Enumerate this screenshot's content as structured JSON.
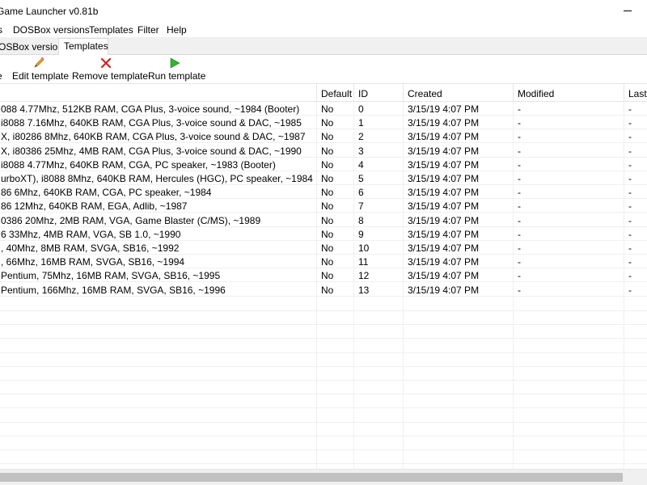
{
  "window": {
    "title": "Game Launcher v0.81b"
  },
  "menu": [
    {
      "label": "s",
      "name": "menu-first"
    },
    {
      "label": "DOSBox versions",
      "name": "menu-dosbox-versions"
    },
    {
      "label": "Templates",
      "name": "menu-templates"
    },
    {
      "label": "Filter",
      "name": "menu-filter"
    },
    {
      "label": "Help",
      "name": "menu-help"
    }
  ],
  "tabs": [
    {
      "label": "OSBox versions",
      "active": false
    },
    {
      "label": "Templates",
      "active": true
    }
  ],
  "toolbar": {
    "partial_label": "e",
    "edit_label": "Edit template",
    "remove_label": "Remove template",
    "run_label": "Run template",
    "colors": {
      "edit_icon": "#e8a21a",
      "remove_icon": "#d81e1e",
      "run_icon": "#2fb52f"
    }
  },
  "table": {
    "columns": [
      "",
      "Default",
      "ID",
      "Created",
      "Modified",
      "Last s"
    ],
    "rows": [
      {
        "name": "088 4.77Mhz, 512KB RAM, CGA Plus, 3-voice sound, ~1984 (Booter)",
        "default": "No",
        "id": "0",
        "created": "3/15/19 4:07 PM",
        "modified": "-",
        "last": "-"
      },
      {
        "name": "i8088 7.16Mhz, 640KB RAM, CGA Plus, 3-voice sound & DAC, ~1985",
        "default": "No",
        "id": "1",
        "created": "3/15/19 4:07 PM",
        "modified": "-",
        "last": "-"
      },
      {
        "name": "X, i80286 8Mhz, 640KB RAM, CGA Plus, 3-voice sound & DAC, ~1987",
        "default": "No",
        "id": "2",
        "created": "3/15/19 4:07 PM",
        "modified": "-",
        "last": "-"
      },
      {
        "name": "X, i80386 25Mhz, 4MB RAM, CGA Plus, 3-voice sound & DAC, ~1990",
        "default": "No",
        "id": "3",
        "created": "3/15/19 4:07 PM",
        "modified": "-",
        "last": "-"
      },
      {
        "name": "i8088 4.77Mhz, 640KB RAM, CGA, PC speaker, ~1983 (Booter)",
        "default": "No",
        "id": "4",
        "created": "3/15/19 4:07 PM",
        "modified": "-",
        "last": "-"
      },
      {
        "name": "urboXT), i8088 8Mhz, 640KB RAM, Hercules (HGC), PC speaker, ~1984",
        "default": "No",
        "id": "5",
        "created": "3/15/19 4:07 PM",
        "modified": "-",
        "last": "-"
      },
      {
        "name": "86 6Mhz, 640KB RAM, CGA, PC speaker, ~1984",
        "default": "No",
        "id": "6",
        "created": "3/15/19 4:07 PM",
        "modified": "-",
        "last": "-"
      },
      {
        "name": "86 12Mhz, 640KB RAM, EGA, Adlib, ~1987",
        "default": "No",
        "id": "7",
        "created": "3/15/19 4:07 PM",
        "modified": "-",
        "last": "-"
      },
      {
        "name": "0386 20Mhz, 2MB RAM, VGA, Game Blaster (C/MS), ~1989",
        "default": "No",
        "id": "8",
        "created": "3/15/19 4:07 PM",
        "modified": "-",
        "last": "-"
      },
      {
        "name": "6 33Mhz, 4MB RAM, VGA, SB 1.0, ~1990",
        "default": "No",
        "id": "9",
        "created": "3/15/19 4:07 PM",
        "modified": "-",
        "last": "-"
      },
      {
        "name": ", 40Mhz, 8MB RAM, SVGA, SB16, ~1992",
        "default": "No",
        "id": "10",
        "created": "3/15/19 4:07 PM",
        "modified": "-",
        "last": "-"
      },
      {
        "name": ", 66Mhz, 16MB RAM, SVGA, SB16, ~1994",
        "default": "No",
        "id": "11",
        "created": "3/15/19 4:07 PM",
        "modified": "-",
        "last": "-"
      },
      {
        "name": "Pentium, 75Mhz, 16MB RAM, SVGA, SB16, ~1995",
        "default": "No",
        "id": "12",
        "created": "3/15/19 4:07 PM",
        "modified": "-",
        "last": "-"
      },
      {
        "name": "Pentium, 166Mhz, 16MB RAM, SVGA, SB16, ~1996",
        "default": "No",
        "id": "13",
        "created": "3/15/19 4:07 PM",
        "modified": "-",
        "last": "-"
      }
    ]
  }
}
